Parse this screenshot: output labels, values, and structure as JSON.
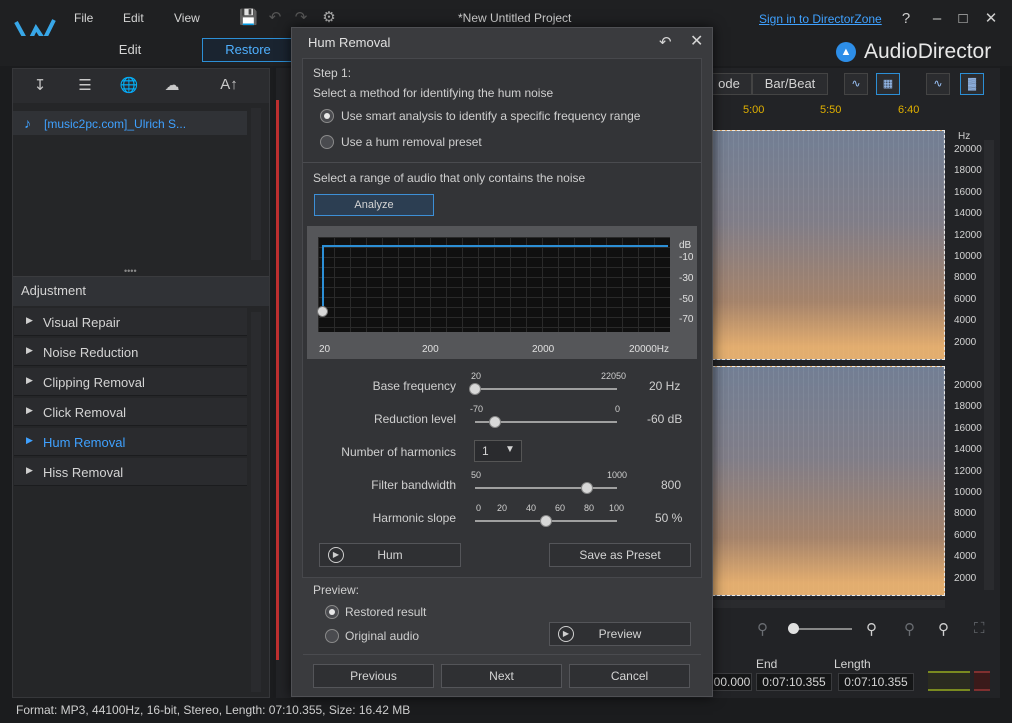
{
  "titlebar": {
    "menu": [
      "File",
      "Edit",
      "View"
    ],
    "project_title": "*New Untitled Project",
    "signin": "Sign in to DirectorZone",
    "help": "?"
  },
  "tabs": {
    "edit": "Edit",
    "restore": "Restore"
  },
  "brand": "AudioDirector",
  "left": {
    "toolbar_text": "A↑",
    "file_name": "[music2pc.com]_Ulrich S...",
    "adjustment_title": "Adjustment",
    "items": [
      {
        "label": "Visual Repair",
        "active": false
      },
      {
        "label": "Noise Reduction",
        "active": false
      },
      {
        "label": "Clipping Removal",
        "active": false
      },
      {
        "label": "Click Removal",
        "active": false
      },
      {
        "label": "Hum Removal",
        "active": true
      },
      {
        "label": "Hiss Removal",
        "active": false
      }
    ]
  },
  "status": "Format: MP3, 44100Hz, 16-bit, Stereo, Length: 07:10.355, Size: 16.42 MB",
  "right": {
    "mode_btn": "ode",
    "barbeat_btn": "Bar/Beat",
    "times": [
      "5:00",
      "5:50",
      "6:40"
    ],
    "hz_unit": "Hz",
    "hz_top": [
      "20000",
      "18000",
      "16000",
      "14000",
      "12000",
      "10000",
      "8000",
      "6000",
      "4000",
      "2000"
    ],
    "hz_bottom": [
      "20000",
      "18000",
      "16000",
      "14000",
      "12000",
      "10000",
      "8000",
      "6000",
      "4000",
      "2000"
    ],
    "end_label": "End",
    "length_label": "Length",
    "start_value": "00.000",
    "end_value": "0:07:10.355",
    "length_value": "0:07:10.355"
  },
  "dialog": {
    "title": "Hum Removal",
    "step": "Step 1:",
    "select_method": "Select a method for identifying the hum noise",
    "opt_smart": "Use smart analysis to identify a specific frequency range",
    "opt_preset": "Use a hum removal preset",
    "select_range": "Select a range of audio that only contains the noise",
    "analyze": "Analyze",
    "db_labels": [
      "dB",
      "-10",
      "-30",
      "-50",
      "-70"
    ],
    "freq_labels": [
      "20",
      "200",
      "2000",
      "20000Hz"
    ],
    "sliders": {
      "base_frequency": {
        "label": "Base frequency",
        "min": "20",
        "max": "22050",
        "value": "20 Hz",
        "fraction": 0.0
      },
      "reduction_level": {
        "label": "Reduction level",
        "min": "-70",
        "max": "0",
        "value": "-60 dB",
        "fraction": 0.14
      },
      "filter_bandwidth": {
        "label": "Filter bandwidth",
        "min": "50",
        "max": "1000",
        "value": "800",
        "fraction": 0.79
      },
      "harmonic_slope": {
        "label": "Harmonic slope",
        "ticks": [
          "0",
          "20",
          "40",
          "60",
          "80",
          "100"
        ],
        "value": "50 %",
        "fraction": 0.5
      }
    },
    "harmonics_label": "Number of harmonics",
    "harmonics_value": "1",
    "hum_btn": "Hum",
    "save_preset": "Save as Preset",
    "preview_label": "Preview:",
    "restored": "Restored result",
    "original": "Original audio",
    "preview_btn": "Preview",
    "previous": "Previous",
    "next": "Next",
    "cancel": "Cancel"
  }
}
